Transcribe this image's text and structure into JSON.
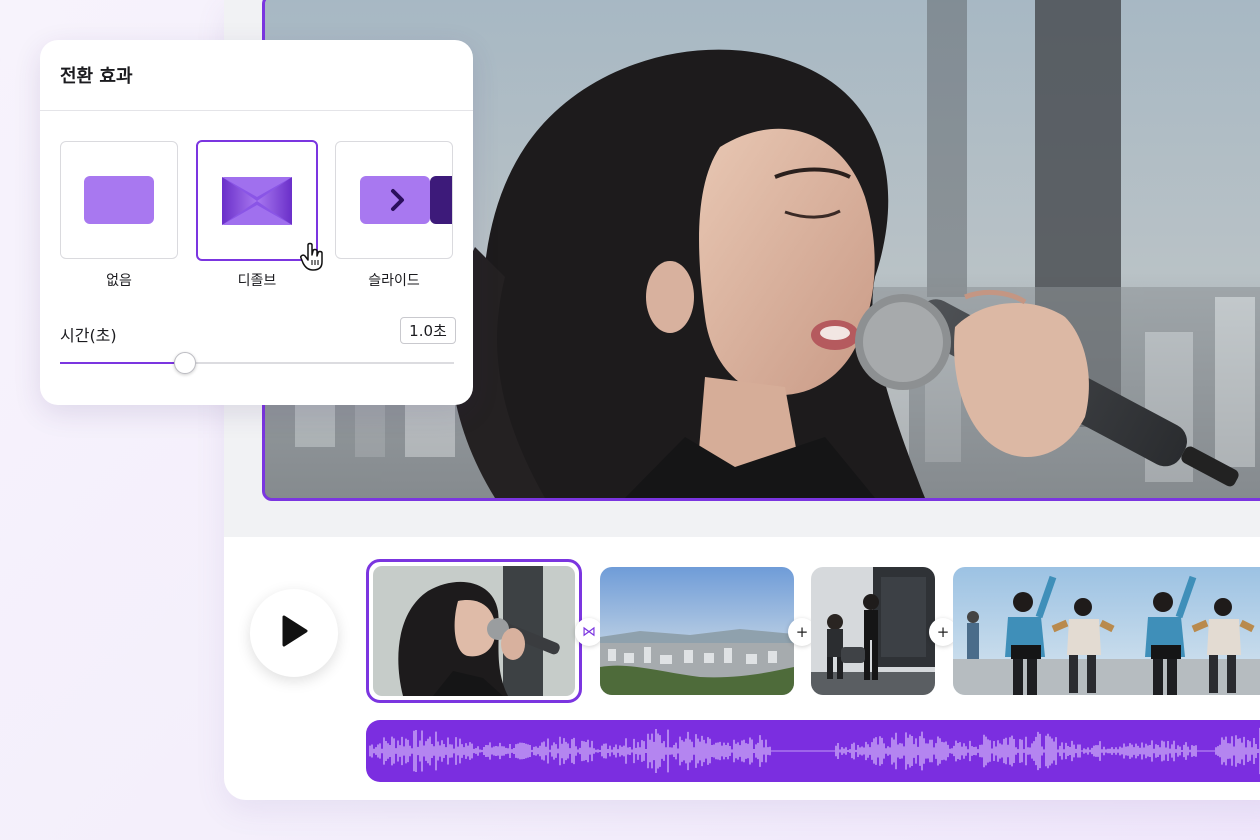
{
  "panel": {
    "title": "전환 효과",
    "options": [
      {
        "label": "없음",
        "selected": false,
        "icon": "none-transition-icon"
      },
      {
        "label": "디졸브",
        "selected": true,
        "icon": "dissolve-transition-icon"
      },
      {
        "label": "슬라이드",
        "selected": false,
        "icon": "slide-transition-icon"
      }
    ],
    "duration_label": "시간(초)",
    "duration_value": "1.0초",
    "duration_fraction": 0.315
  },
  "timeline": {
    "clips": [
      {
        "name": "singer-closeup",
        "selected": true
      },
      {
        "name": "city-skyline",
        "selected": false
      },
      {
        "name": "band-on-stage",
        "selected": false
      },
      {
        "name": "dancers",
        "selected": false
      }
    ],
    "joiners": [
      {
        "symbol": "⋈",
        "active": true
      },
      {
        "symbol": "+",
        "active": false
      },
      {
        "symbol": "+",
        "active": false
      }
    ]
  },
  "colors": {
    "accent": "#7b35e0",
    "audio_track": "#7b2ee0"
  }
}
